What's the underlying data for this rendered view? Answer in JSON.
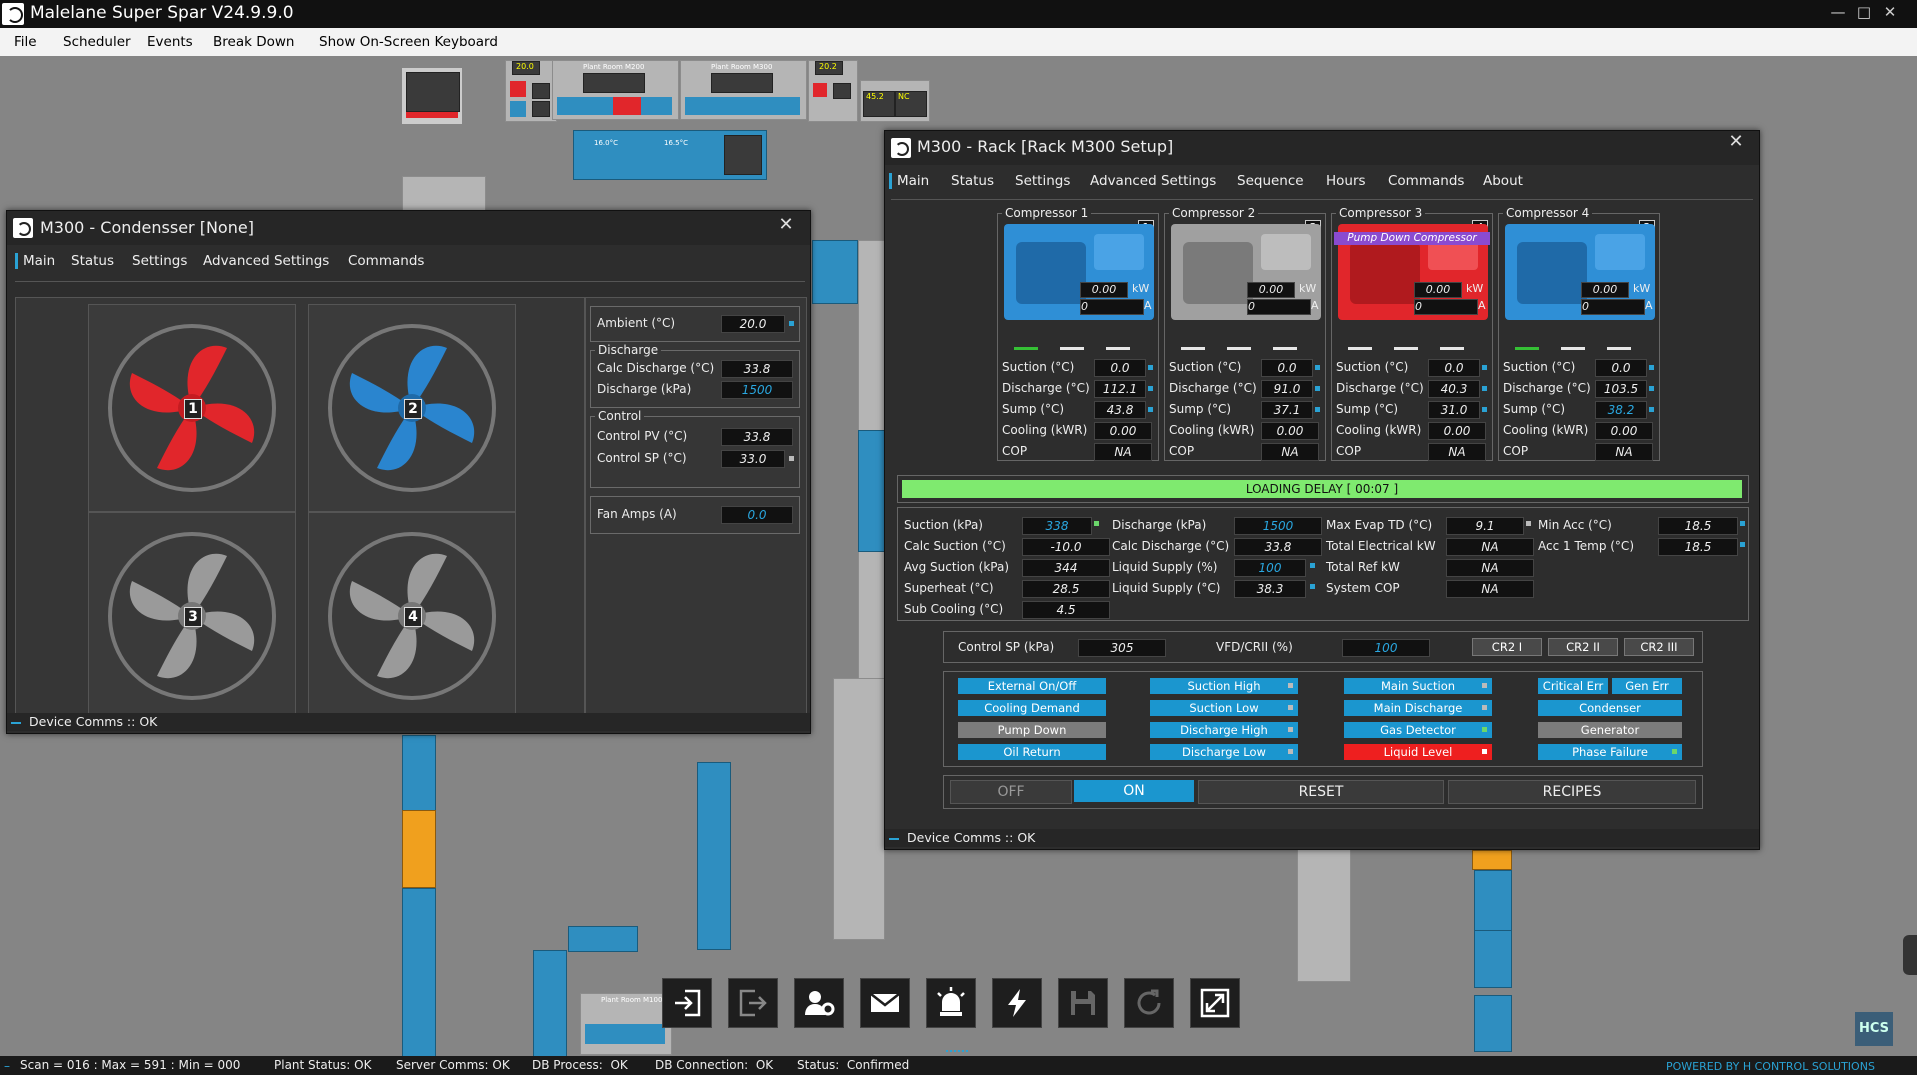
{
  "app": {
    "title": "Malelane Super Spar V24.9.9.0"
  },
  "menu": [
    "File",
    "Scheduler",
    "Events",
    "Break Down",
    "Show On-Screen Keyboard"
  ],
  "background": {
    "mini_labels": [
      "20.0",
      "Plant Room M200",
      "Plant Room M300",
      "20.2",
      "45.2",
      "NC",
      "NC",
      "16.0°C",
      "16.5°C",
      "Plant Room M100"
    ]
  },
  "condenser": {
    "title": "M300 - Condensser [None]",
    "tabs": [
      "Main",
      "Status",
      "Settings",
      "Advanced Settings",
      "Commands"
    ],
    "fans": [
      "1",
      "2",
      "3",
      "4"
    ],
    "fan_colors": [
      "#e1262b",
      "#2a85cf",
      "#9a9a9a",
      "#9a9a9a"
    ],
    "ambient": {
      "label": "Ambient (°C)",
      "value": "20.0"
    },
    "discharge_group": "Discharge",
    "calc_discharge": {
      "label": "Calc Discharge (°C)",
      "value": "33.8"
    },
    "discharge_kpa": {
      "label": "Discharge (kPa)",
      "value": "1500"
    },
    "control_group": "Control",
    "control_pv": {
      "label": "Control PV (°C)",
      "value": "33.8"
    },
    "control_sp": {
      "label": "Control SP (°C)",
      "value": "33.0"
    },
    "fan_amps": {
      "label": "Fan Amps (A)",
      "value": "0.0"
    },
    "footer": "Device Comms :: OK"
  },
  "rack": {
    "title": "M300 - Rack [Rack M300 Setup]",
    "tabs": [
      "Main",
      "Status",
      "Settings",
      "Advanced Settings",
      "Sequence",
      "Hours",
      "Commands",
      "About"
    ],
    "compressors": [
      {
        "name": "Compressor 1",
        "badge": "1",
        "kw": "0.00",
        "a": "0",
        "color": "#2f8fd6",
        "tag": "",
        "suction": "0.0",
        "discharge": "112.1",
        "sump": "43.8",
        "cooling": "0.00",
        "cop": "NA",
        "bars": [
          "#35c035",
          "#e6e6e6",
          "#e6e6e6"
        ]
      },
      {
        "name": "Compressor 2",
        "badge": "3",
        "kw": "0.00",
        "a": "0",
        "color": "#a0a0a0",
        "tag": "",
        "suction": "0.0",
        "discharge": "91.0",
        "sump": "37.1",
        "cooling": "0.00",
        "cop": "NA",
        "bars": [
          "#e6e6e6",
          "#e6e6e6",
          "#e6e6e6"
        ]
      },
      {
        "name": "Compressor 3",
        "badge": "4",
        "kw": "0.00",
        "a": "0",
        "color": "#e1262b",
        "tag": "Pump Down Compressor",
        "suction": "0.0",
        "discharge": "40.3",
        "sump": "31.0",
        "cooling": "0.00",
        "cop": "NA",
        "bars": [
          "#e6e6e6",
          "#e6e6e6",
          "#e6e6e6"
        ]
      },
      {
        "name": "Compressor 4",
        "badge": "2",
        "kw": "0.00",
        "a": "0",
        "color": "#2f8fd6",
        "tag": "",
        "suction": "0.0",
        "discharge": "103.5",
        "sump": "38.2",
        "cooling": "0.00",
        "cop": "NA",
        "bars": [
          "#35c035",
          "#e6e6e6",
          "#e6e6e6"
        ]
      }
    ],
    "row_labels": {
      "suction": "Suction (°C)",
      "discharge": "Discharge (°C)",
      "sump": "Sump (°C)",
      "cooling": "Cooling (kWR)",
      "cop": "COP",
      "kw": "kW",
      "a": "A"
    },
    "loading_delay": "LOADING DELAY [ 00:07 ]",
    "stats": [
      [
        {
          "label": "Suction (kPa)",
          "value": "338"
        },
        {
          "label": "Calc Suction (°C)",
          "value": "-10.0"
        },
        {
          "label": "Avg Suction (kPa)",
          "value": "344"
        },
        {
          "label": "Superheat (°C)",
          "value": "28.5"
        },
        {
          "label": "Sub Cooling (°C)",
          "value": "4.5"
        }
      ],
      [
        {
          "label": "Discharge (kPa)",
          "value": "1500"
        },
        {
          "label": "Calc Discharge (°C)",
          "value": "33.8"
        },
        {
          "label": "Liquid Supply (%)",
          "value": "100"
        },
        {
          "label": "Liquid Supply (°C)",
          "value": "38.3"
        }
      ],
      [
        {
          "label": "Max Evap TD (°C)",
          "value": "9.1"
        },
        {
          "label": "Total Electrical kW",
          "value": "NA"
        },
        {
          "label": "Total Ref kW",
          "value": "NA"
        },
        {
          "label": "System COP",
          "value": "NA"
        }
      ],
      [
        {
          "label": "Min Acc (°C)",
          "value": "18.5"
        },
        {
          "label": "Acc 1 Temp (°C)",
          "value": "18.5"
        }
      ]
    ],
    "control_sp": {
      "label": "Control SP (kPa)",
      "value": "305"
    },
    "vfd": {
      "label": "VFD/CRII (%)",
      "value": "100"
    },
    "cr_buttons": [
      "CR2 I",
      "CR2 II",
      "CR2 III"
    ],
    "alarms_col1": [
      {
        "t": "External On/Off",
        "c": "blue"
      },
      {
        "t": "Cooling Demand",
        "c": "blue"
      },
      {
        "t": "Pump Down",
        "c": "grey"
      },
      {
        "t": "Oil Return",
        "c": "blue"
      }
    ],
    "alarms_col2": [
      {
        "t": "Suction High",
        "c": "blue"
      },
      {
        "t": "Suction Low",
        "c": "blue"
      },
      {
        "t": "Discharge High",
        "c": "blue"
      },
      {
        "t": "Discharge Low",
        "c": "blue"
      }
    ],
    "alarms_col3": [
      {
        "t": "Main Suction",
        "c": "blue"
      },
      {
        "t": "Main Discharge",
        "c": "blue"
      },
      {
        "t": "Gas Detector",
        "c": "blue"
      },
      {
        "t": "Liquid Level",
        "c": "red"
      }
    ],
    "alarms_col4": [
      {
        "t": "Critical Err",
        "c": "blue"
      },
      {
        "t": "Gen Err",
        "c": "blue"
      },
      {
        "t": "Condenser",
        "c": "blue"
      },
      {
        "t": "Generator",
        "c": "grey"
      },
      {
        "t": "Phase Failure",
        "c": "blue"
      }
    ],
    "controls": {
      "off": "OFF",
      "on": "ON",
      "reset": "RESET",
      "recipes": "RECIPES"
    },
    "footer": "Device Comms :: OK"
  },
  "dock": [
    "login-icon",
    "logout-icon",
    "user-settings-icon",
    "mail-icon",
    "alarm-icon",
    "lightning-icon",
    "save-icon",
    "refresh-icon",
    "expand-icon"
  ],
  "status_bar": {
    "scan": "Scan = 016 : Max = 591 : Min = 000",
    "plant": "Plant Status: OK",
    "server": "Server Comms: OK",
    "db_process": "DB Process:  OK",
    "db_conn": "DB Connection:  OK",
    "status": "Status:  Confirmed",
    "brand": "POWERED BY H CONTROL SOLUTIONS"
  },
  "logo": "HCS",
  "colors": {
    "accent": "#2aa2d4",
    "green": "#35c035",
    "red": "#e1262b"
  }
}
